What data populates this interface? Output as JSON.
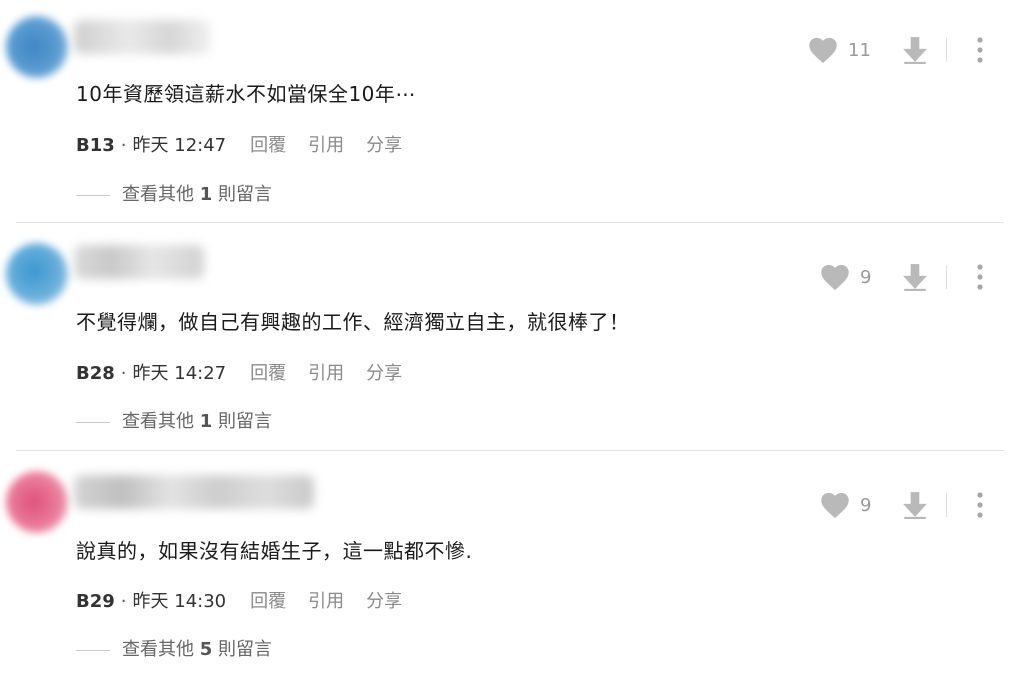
{
  "comments": [
    {
      "text": "10年資歷領這薪水不如當保全10年⋯",
      "floor": "B13",
      "dot": "·",
      "time": "昨天 12:47",
      "reply_label": "回覆",
      "quote_label": "引用",
      "share_label": "分享",
      "likes": "11",
      "more_replies_prefix": "查看其他",
      "more_replies_count": "1",
      "more_replies_suffix": "則留言",
      "avatar_color": "#3f86c4"
    },
    {
      "text": "不覺得爛，做自己有興趣的工作、經濟獨立自主，就很棒了！",
      "floor": "B28",
      "dot": "·",
      "time": "昨天 14:27",
      "reply_label": "回覆",
      "quote_label": "引用",
      "share_label": "分享",
      "likes": "9",
      "more_replies_prefix": "查看其他",
      "more_replies_count": "1",
      "more_replies_suffix": "則留言",
      "avatar_color": "#3b97cf"
    },
    {
      "text": "說真的，如果沒有結婚生子，這一點都不慘.",
      "floor": "B29",
      "dot": "·",
      "time": "昨天 14:30",
      "reply_label": "回覆",
      "quote_label": "引用",
      "share_label": "分享",
      "likes": "9",
      "more_replies_prefix": "查看其他",
      "more_replies_count": "5",
      "more_replies_suffix": "則留言",
      "avatar_color": "#e0507a"
    }
  ],
  "colors": {
    "icon_gray": "#b9b9b9",
    "count_gray": "#999999",
    "action_gray": "#8a8a8a"
  },
  "icons": [
    "heart-icon",
    "arrow-down-icon",
    "more-vertical-icon"
  ]
}
